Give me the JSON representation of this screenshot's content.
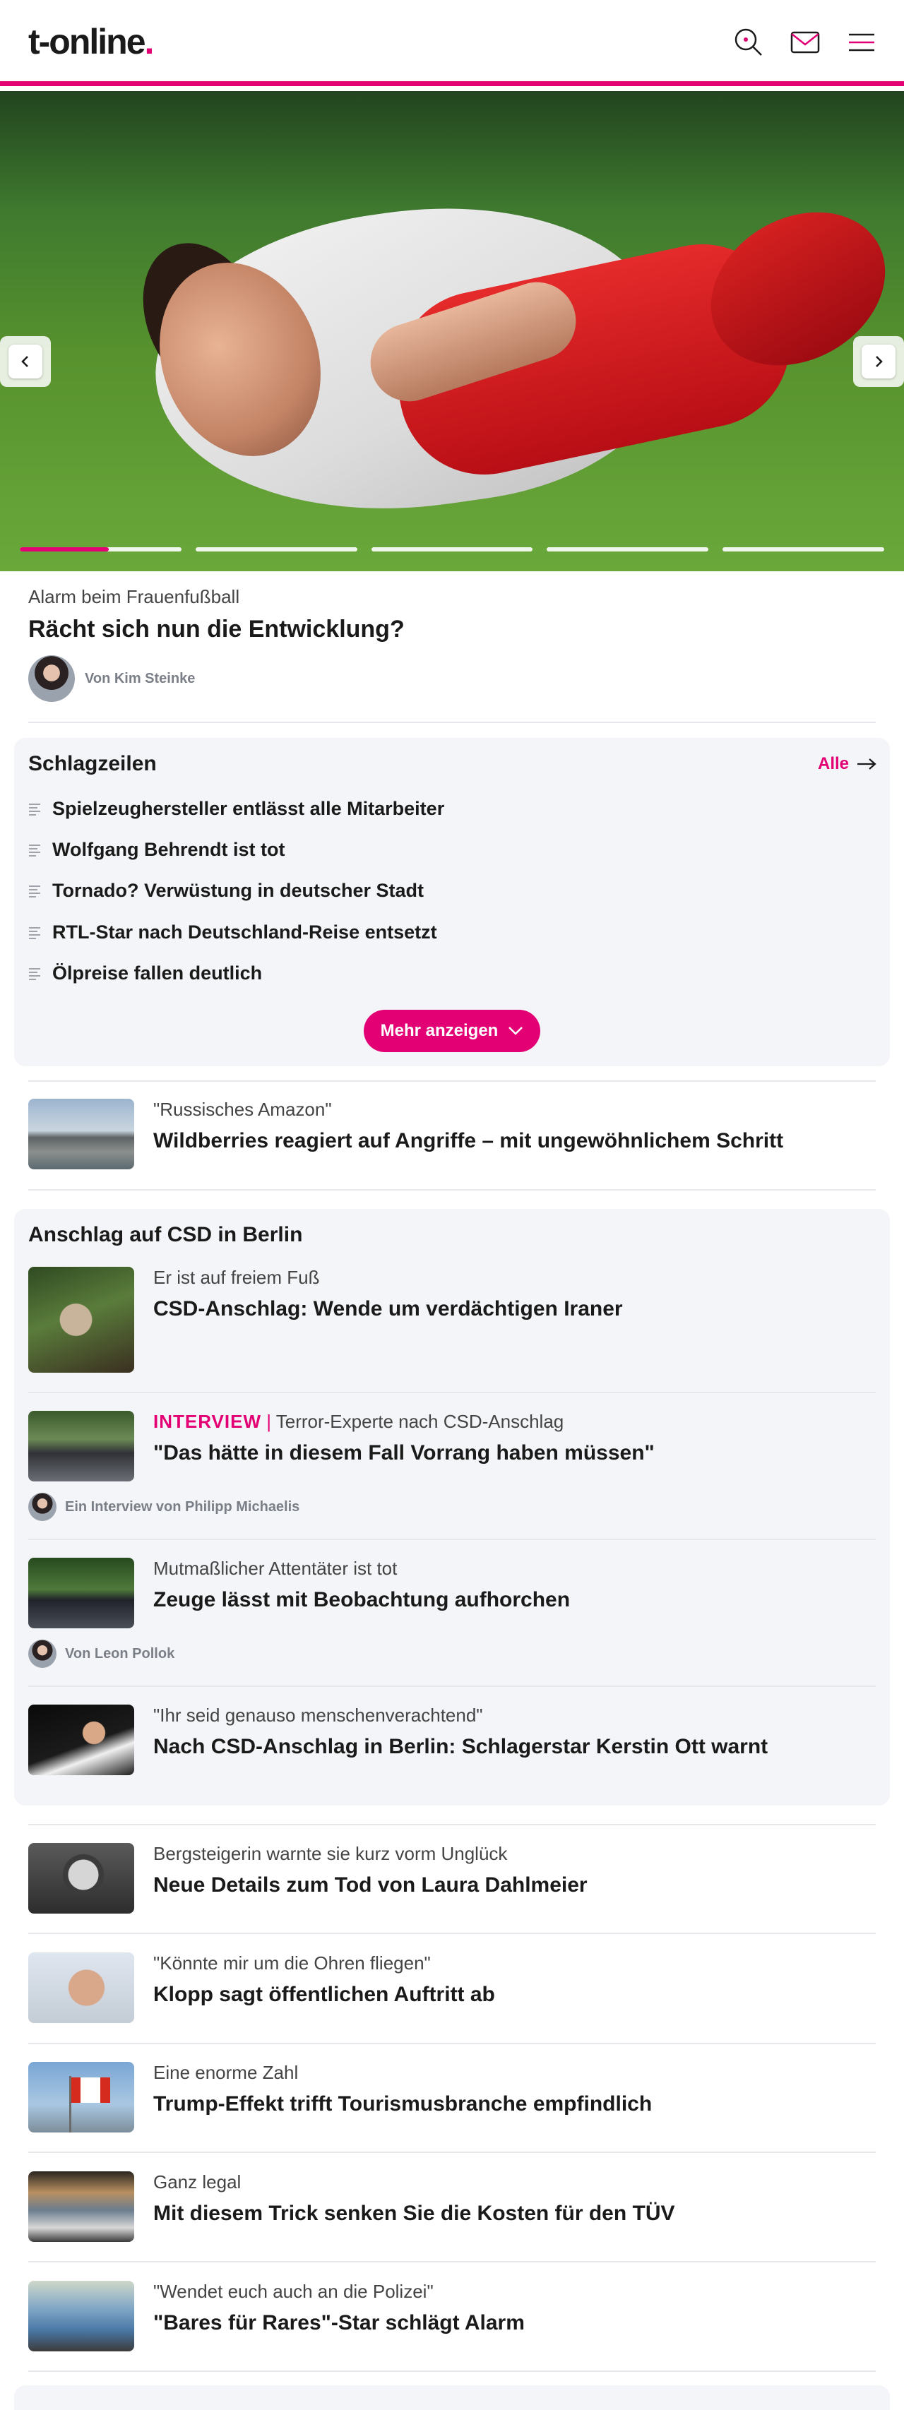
{
  "header": {
    "logo_main": "t-online",
    "logo_dot": ".",
    "icons": [
      "search-icon",
      "mail-icon",
      "menu-icon"
    ],
    "accent": "#e20074"
  },
  "hero": {
    "kicker": "Alarm beim Frauenfußball",
    "headline": "Rächt sich nun die Entwicklung?",
    "author": "Von Kim Steinke",
    "slides_total": 5,
    "active_slide": 1,
    "active_slide_progress": 0.55
  },
  "schlagzeilen": {
    "title": "Schlagzeilen",
    "all_label": "Alle",
    "items": [
      "Spielzeughersteller entlässt alle Mitarbeiter",
      "Wolfgang Behrendt ist tot",
      "Tornado? Verwüstung in deutscher Stadt",
      "RTL-Star nach Deutschland-Reise entsetzt",
      "Ölpreise fallen deutlich"
    ],
    "more_label": "Mehr anzeigen"
  },
  "teaser_wildberries": {
    "kicker": "\"Russisches Amazon\"",
    "headline": "Wildberries reagiert auf Angriffe – mit ungewöhnlichem Schritt"
  },
  "csd": {
    "title": "Anschlag auf CSD in Berlin",
    "items": [
      {
        "kicker": "Er ist auf freiem Fuß",
        "headline": "CSD-Anschlag: Wende um verdächtigen Iraner"
      },
      {
        "label": "INTERVIEW",
        "separator": "|",
        "kicker": "Terror-Experte nach CSD-Anschlag",
        "headline": "\"Das hätte in diesem Fall Vorrang haben müssen\"",
        "author": "Ein Interview von Philipp Michaelis"
      },
      {
        "kicker": "Mutmaßlicher Attentäter ist tot",
        "headline": "Zeuge lässt mit Beobachtung aufhorchen",
        "author": "Von Leon Pollok"
      },
      {
        "kicker": "\"Ihr seid genauso menschenverachtend\"",
        "headline": "Nach CSD-Anschlag in Berlin: Schlagerstar Kerstin Ott warnt"
      }
    ]
  },
  "teasers": [
    {
      "kicker": "Bergsteigerin warnte sie kurz vorm Unglück",
      "headline": "Neue Details zum Tod von Laura Dahlmeier"
    },
    {
      "kicker": "\"Könnte mir um die Ohren fliegen\"",
      "headline": "Klopp sagt öffentlichen Auftritt ab"
    },
    {
      "kicker": "Eine enorme Zahl",
      "headline": "Trump-Effekt trifft Tourismusbranche empfindlich"
    },
    {
      "kicker": "Ganz legal",
      "headline": "Mit diesem Trick senken Sie die Kosten für den TÜV"
    },
    {
      "kicker": "\"Wendet euch auch an die Polizei\"",
      "headline": "\"Bares für Rares\"-Star schlägt Alarm"
    }
  ]
}
